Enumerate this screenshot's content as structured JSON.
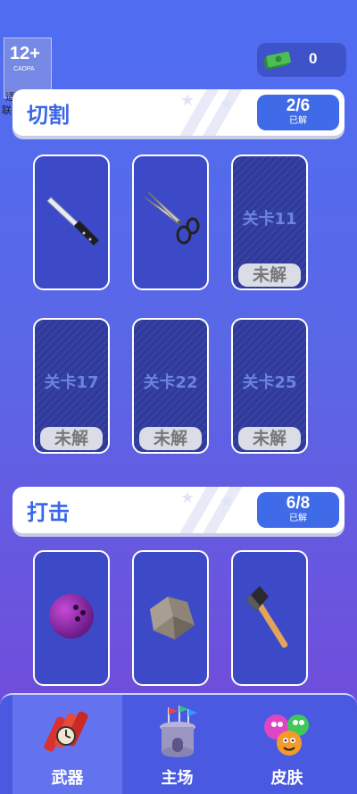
{
  "age_rating": {
    "number": "12+",
    "org": "CADPA",
    "line1": "适龄提示",
    "line2": "联系客服"
  },
  "currency": {
    "icon": "cash-icon",
    "value": "0"
  },
  "sections": [
    {
      "title": "切割",
      "progress": "2/6",
      "progress_label": "已解",
      "cards": [
        {
          "unlocked": true,
          "icon": "knife-icon"
        },
        {
          "unlocked": true,
          "icon": "scissors-icon"
        },
        {
          "unlocked": false,
          "level": "关卡11",
          "lock_label": "未解"
        },
        {
          "unlocked": false,
          "level": "关卡17",
          "lock_label": "未解"
        },
        {
          "unlocked": false,
          "level": "关卡22",
          "lock_label": "未解"
        },
        {
          "unlocked": false,
          "level": "关卡25",
          "lock_label": "未解"
        }
      ]
    },
    {
      "title": "打击",
      "progress": "6/8",
      "progress_label": "已解",
      "cards": [
        {
          "unlocked": true,
          "icon": "bowling-ball-icon"
        },
        {
          "unlocked": true,
          "icon": "rock-icon"
        },
        {
          "unlocked": true,
          "icon": "axe-icon"
        }
      ]
    }
  ],
  "nav": {
    "tabs": [
      {
        "label": "武器",
        "icon": "dynamite-icon",
        "active": true
      },
      {
        "label": "主场",
        "icon": "castle-icon",
        "active": false
      },
      {
        "label": "皮肤",
        "icon": "blobs-icon",
        "active": false
      }
    ]
  },
  "colors": {
    "accent": "#3a67e8",
    "progress_bg": "#3f6ae8",
    "card_bg": "#3d4ac7",
    "nav_bg": "#4a5ae0"
  }
}
